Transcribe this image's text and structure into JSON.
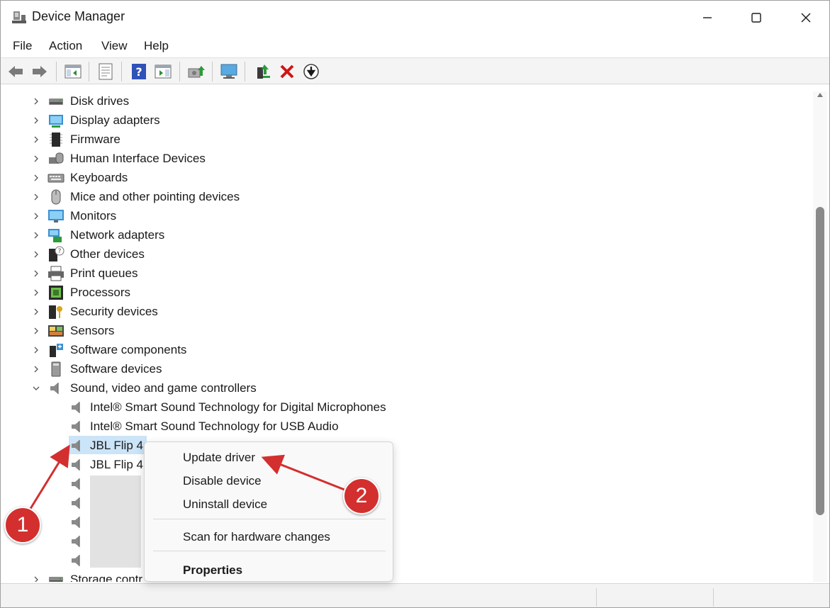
{
  "window": {
    "title": "Device Manager",
    "icon": "device-manager-icon"
  },
  "menu": [
    "File",
    "Action",
    "View",
    "Help"
  ],
  "toolbar": {
    "icons": [
      "back-icon",
      "forward-icon",
      "show-hide-console-tree-icon",
      "properties-icon",
      "help-icon",
      "action-pane-icon",
      "update-driver-icon",
      "scan-hardware-icon",
      "enable-device-icon",
      "uninstall-icon",
      "disable-icon"
    ]
  },
  "tree": {
    "categories": [
      {
        "label": "Disk drives",
        "icon": "disk-drive-icon",
        "expanded": false
      },
      {
        "label": "Display adapters",
        "icon": "display-adapter-icon",
        "expanded": false
      },
      {
        "label": "Firmware",
        "icon": "firmware-icon",
        "expanded": false
      },
      {
        "label": "Human Interface Devices",
        "icon": "hid-icon",
        "expanded": false
      },
      {
        "label": "Keyboards",
        "icon": "keyboard-icon",
        "expanded": false
      },
      {
        "label": "Mice and other pointing devices",
        "icon": "mouse-icon",
        "expanded": false
      },
      {
        "label": "Monitors",
        "icon": "monitor-icon",
        "expanded": false
      },
      {
        "label": "Network adapters",
        "icon": "network-adapter-icon",
        "expanded": false
      },
      {
        "label": "Other devices",
        "icon": "other-devices-icon",
        "expanded": false
      },
      {
        "label": "Print queues",
        "icon": "printer-icon",
        "expanded": false
      },
      {
        "label": "Processors",
        "icon": "processor-icon",
        "expanded": false
      },
      {
        "label": "Security devices",
        "icon": "security-device-icon",
        "expanded": false
      },
      {
        "label": "Sensors",
        "icon": "sensor-icon",
        "expanded": false
      },
      {
        "label": "Software components",
        "icon": "software-component-icon",
        "expanded": false
      },
      {
        "label": "Software devices",
        "icon": "software-device-icon",
        "expanded": false
      },
      {
        "label": "Sound, video and game controllers",
        "icon": "speaker-icon",
        "expanded": true
      }
    ],
    "sound_children": [
      {
        "label": "Intel® Smart Sound Technology for Digital Microphones"
      },
      {
        "label": "Intel® Smart Sound Technology for USB Audio"
      },
      {
        "label": "JBL Flip 4",
        "selected": true
      },
      {
        "label": "JBL Flip 4"
      }
    ],
    "partial_last": "Storage contr"
  },
  "context_menu": {
    "items": [
      "Update driver",
      "Disable device",
      "Uninstall device",
      "Scan for hardware changes",
      "Properties"
    ]
  },
  "annotations": {
    "badge_1": "1",
    "badge_2": "2",
    "color": "#d32f2f"
  }
}
